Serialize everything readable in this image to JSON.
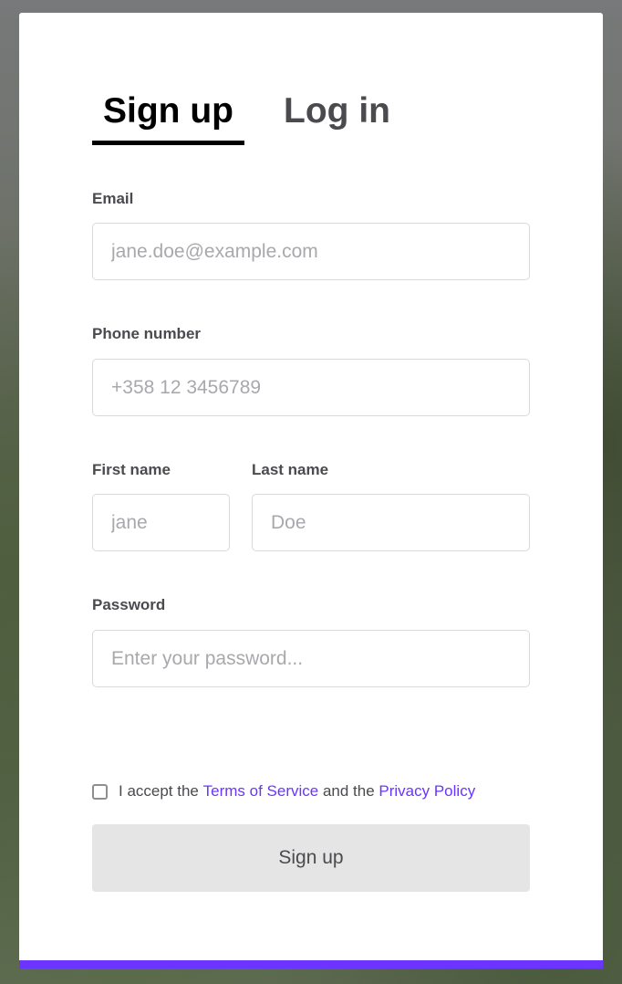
{
  "tabs": {
    "signup": "Sign up",
    "login": "Log in"
  },
  "form": {
    "email": {
      "label": "Email",
      "placeholder": "jane.doe@example.com"
    },
    "phone": {
      "label": "Phone number",
      "placeholder": "+358 12 3456789"
    },
    "first_name": {
      "label": "First name",
      "placeholder": "jane"
    },
    "last_name": {
      "label": "Last name",
      "placeholder": "Doe"
    },
    "password": {
      "label": "Password",
      "placeholder": "Enter your password..."
    }
  },
  "terms": {
    "prefix": "I accept the ",
    "tos": "Terms of Service",
    "middle": " and the ",
    "privacy": "Privacy Policy",
    "checked": false
  },
  "submit_label": "Sign up",
  "colors": {
    "accent": "#6b35ff",
    "button_bg": "#e5e5e5"
  }
}
